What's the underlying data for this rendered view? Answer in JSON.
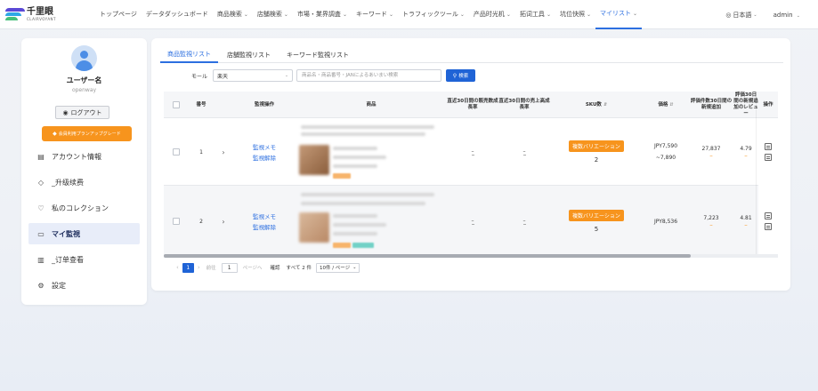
{
  "brand": {
    "name_cn": "千里眼",
    "name_en": "CLAIRVOYANT"
  },
  "nav": {
    "items": [
      {
        "label": "トップページ",
        "chevron": false
      },
      {
        "label": "データダッシュボード",
        "chevron": false
      },
      {
        "label": "商品検索",
        "chevron": true
      },
      {
        "label": "店舗検索",
        "chevron": true
      },
      {
        "label": "市場・業界調査",
        "chevron": true
      },
      {
        "label": "キーワード",
        "chevron": true
      },
      {
        "label": "トラフィックツール",
        "chevron": true
      },
      {
        "label": "产品时光机",
        "chevron": true
      },
      {
        "label": "拓词工具",
        "chevron": true
      },
      {
        "label": "坑位快照",
        "chevron": true
      },
      {
        "label": "マイリスト",
        "chevron": true,
        "active": true
      }
    ],
    "language": "日本語",
    "user": "admin"
  },
  "sidebar": {
    "username": "ユーザー名",
    "user_id": "openway",
    "logout_label": "ログアウト",
    "upgrade_label": "会員利用プランアップグレード",
    "menu": [
      {
        "label": "アカウント情報",
        "icon": "id-card-icon"
      },
      {
        "label": "_升级续费",
        "icon": "diamond-icon"
      },
      {
        "label": "私のコレクション",
        "icon": "heart-icon"
      },
      {
        "label": "マイ監視",
        "icon": "monitor-icon",
        "active": true
      },
      {
        "label": "_订单查看",
        "icon": "order-icon"
      },
      {
        "label": "設定",
        "icon": "gear-icon"
      }
    ]
  },
  "tabs": [
    {
      "label": "商品監視リスト",
      "active": true
    },
    {
      "label": "店舗監視リスト",
      "active": false
    },
    {
      "label": "キーワード監視リスト",
      "active": false
    }
  ],
  "filter": {
    "mall_label": "モール",
    "mall_value": "楽天",
    "search_placeholder": "商品名・商品番号・JANによるあいまい検索",
    "search_button": "検索"
  },
  "table": {
    "headers": {
      "index": "番号",
      "monitor_ops": "監視操作",
      "product": "商品",
      "growth_30d_sales": "直近30日間の販売数成長率",
      "growth_30d_revenue": "直近30日間の売上高成長率",
      "sku": "SKU数",
      "price": "価格",
      "review_count": "評価件数30日間の新規追加",
      "review_rating": "評価30日間の新規追加のレビュー",
      "actions": "操作"
    },
    "rows": [
      {
        "index": "1",
        "monitor_memo": "監視メモ",
        "monitor_cancel": "監視解除",
        "growth_sales": "–",
        "growth_revenue": "–",
        "sku_badge": "複数バリエーション",
        "sku_count": "2",
        "price_main": "JPY7,590",
        "price_alt": "~7,890",
        "review_count": "27,837",
        "review_count_new": "–",
        "rating": "4.79",
        "rating_new": "–"
      },
      {
        "index": "2",
        "monitor_memo": "監視メモ",
        "monitor_cancel": "監視解除",
        "growth_sales": "–",
        "growth_revenue": "–",
        "sku_badge": "複数バリエーション",
        "sku_count": "5",
        "price_main": "JPY8,536",
        "price_alt": "",
        "review_count": "7,223",
        "review_count_new": "–",
        "rating": "4.81",
        "rating_new": "–"
      }
    ]
  },
  "pagination": {
    "current_page": "1",
    "prev_page_text": "前往",
    "page_input": "1",
    "page_suffix": "ページへ",
    "confirm": "確認",
    "total": "すべて 2 件",
    "page_size": "10件 / ページ"
  },
  "colors": {
    "accent": "#2c6fe0",
    "primary_button": "#1f63d6",
    "orange": "#f7941d"
  }
}
